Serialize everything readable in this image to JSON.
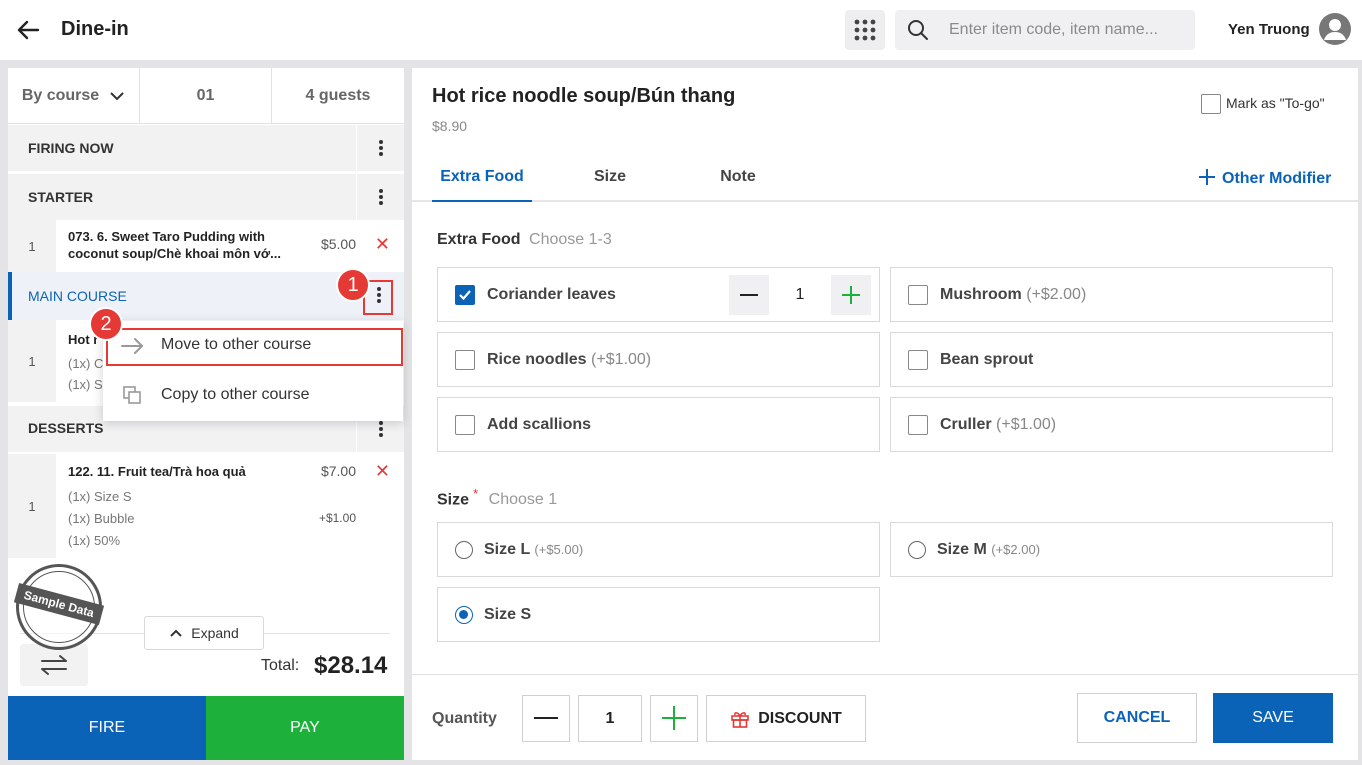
{
  "header": {
    "title": "Dine-in",
    "search_placeholder": "Enter item code, item name...",
    "user": "Yen Truong"
  },
  "left": {
    "tabs": [
      "By course",
      "01",
      "4 guests"
    ],
    "courses": {
      "firing": "FIRING NOW",
      "starter": "STARTER",
      "main": "MAIN COURSE",
      "desserts": "DESSERTS"
    },
    "items": [
      {
        "qty": "1",
        "name1": "073. 6. Sweet Taro Pudding with",
        "name2": "coconut soup/Chè khoai môn vớ...",
        "price": "$5.00"
      },
      {
        "qty": "1",
        "name": "Hot r",
        "mod1": "(1x) C",
        "mod2": "(1x) S"
      },
      {
        "qty": "1",
        "name": "122. 11. Fruit tea/Trà hoa quả",
        "price": "$7.00",
        "mods": [
          "(1x) Size S",
          "(1x) Bubble",
          "(1x) 50%"
        ],
        "mod_price": "+$1.00"
      }
    ],
    "menu": {
      "move": "Move to other course",
      "copy": "Copy to other course"
    },
    "badges": [
      "1",
      "2"
    ],
    "watermark": "Sample Data",
    "expand": "Expand",
    "total_label": "Total:",
    "total": "$28.14",
    "fire": "FIRE",
    "pay": "PAY"
  },
  "right": {
    "title": "Hot rice noodle soup/Bún thang",
    "price": "$8.90",
    "togo": "Mark as \"To-go\"",
    "tabs": [
      "Extra Food",
      "Size",
      "Note"
    ],
    "other_modifier": "Other Modifier",
    "extra": {
      "label": "Extra Food",
      "hint": "Choose 1-3",
      "options": [
        {
          "name": "Coriander leaves",
          "extra": "",
          "checked": true,
          "qty": "1"
        },
        {
          "name": "Mushroom",
          "extra": "(+$2.00)"
        },
        {
          "name": "Rice noodles",
          "extra": "(+$1.00)"
        },
        {
          "name": "Bean sprout",
          "extra": ""
        },
        {
          "name": "Add scallions",
          "extra": ""
        },
        {
          "name": "Cruller",
          "extra": "(+$1.00)"
        }
      ]
    },
    "size": {
      "label": "Size",
      "required": "*",
      "hint": "Choose 1",
      "options": [
        {
          "name": "Size L",
          "extra": "(+$5.00)"
        },
        {
          "name": "Size M",
          "extra": "(+$2.00)"
        },
        {
          "name": "Size S",
          "extra": "",
          "selected": true
        }
      ]
    },
    "footer": {
      "quantity_label": "Quantity",
      "quantity": "1",
      "discount": "DISCOUNT",
      "cancel": "CANCEL",
      "save": "SAVE"
    }
  },
  "colors": {
    "primary": "#0b63b8",
    "green": "#1db03a",
    "red": "#e53935"
  }
}
